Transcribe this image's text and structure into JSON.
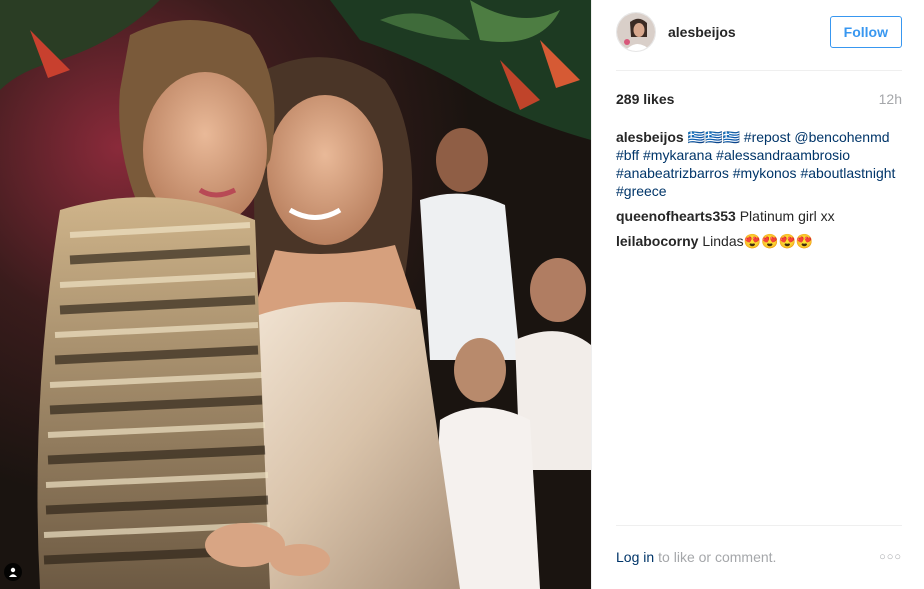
{
  "photo": {
    "alt_icon": "person-tag-icon"
  },
  "header": {
    "username": "alesbeijos",
    "follow_label": "Follow"
  },
  "meta": {
    "likes": "289 likes",
    "time": "12h"
  },
  "caption": {
    "user": "alesbeijos",
    "text": "🇬🇷🇬🇷🇬🇷",
    "tags": [
      "#repost",
      "@bencohenmd",
      "#bff",
      "#mykarana",
      "#alessandraambrosio",
      "#anabeatrizbarros",
      "#mykonos",
      "#aboutlastnight",
      "#greece"
    ]
  },
  "comments": [
    {
      "user": "queenofhearts353",
      "text": "Platinum girl xx"
    },
    {
      "user": "leilabocorny",
      "text": "Lindas😍😍😍😍"
    }
  ],
  "footer": {
    "login_label": "Log in",
    "suffix": "to like or comment.",
    "more_icon": "ellipsis-icon"
  },
  "colors": {
    "accent": "#3897f0",
    "link": "#003569",
    "muted": "#a5a7aa"
  }
}
